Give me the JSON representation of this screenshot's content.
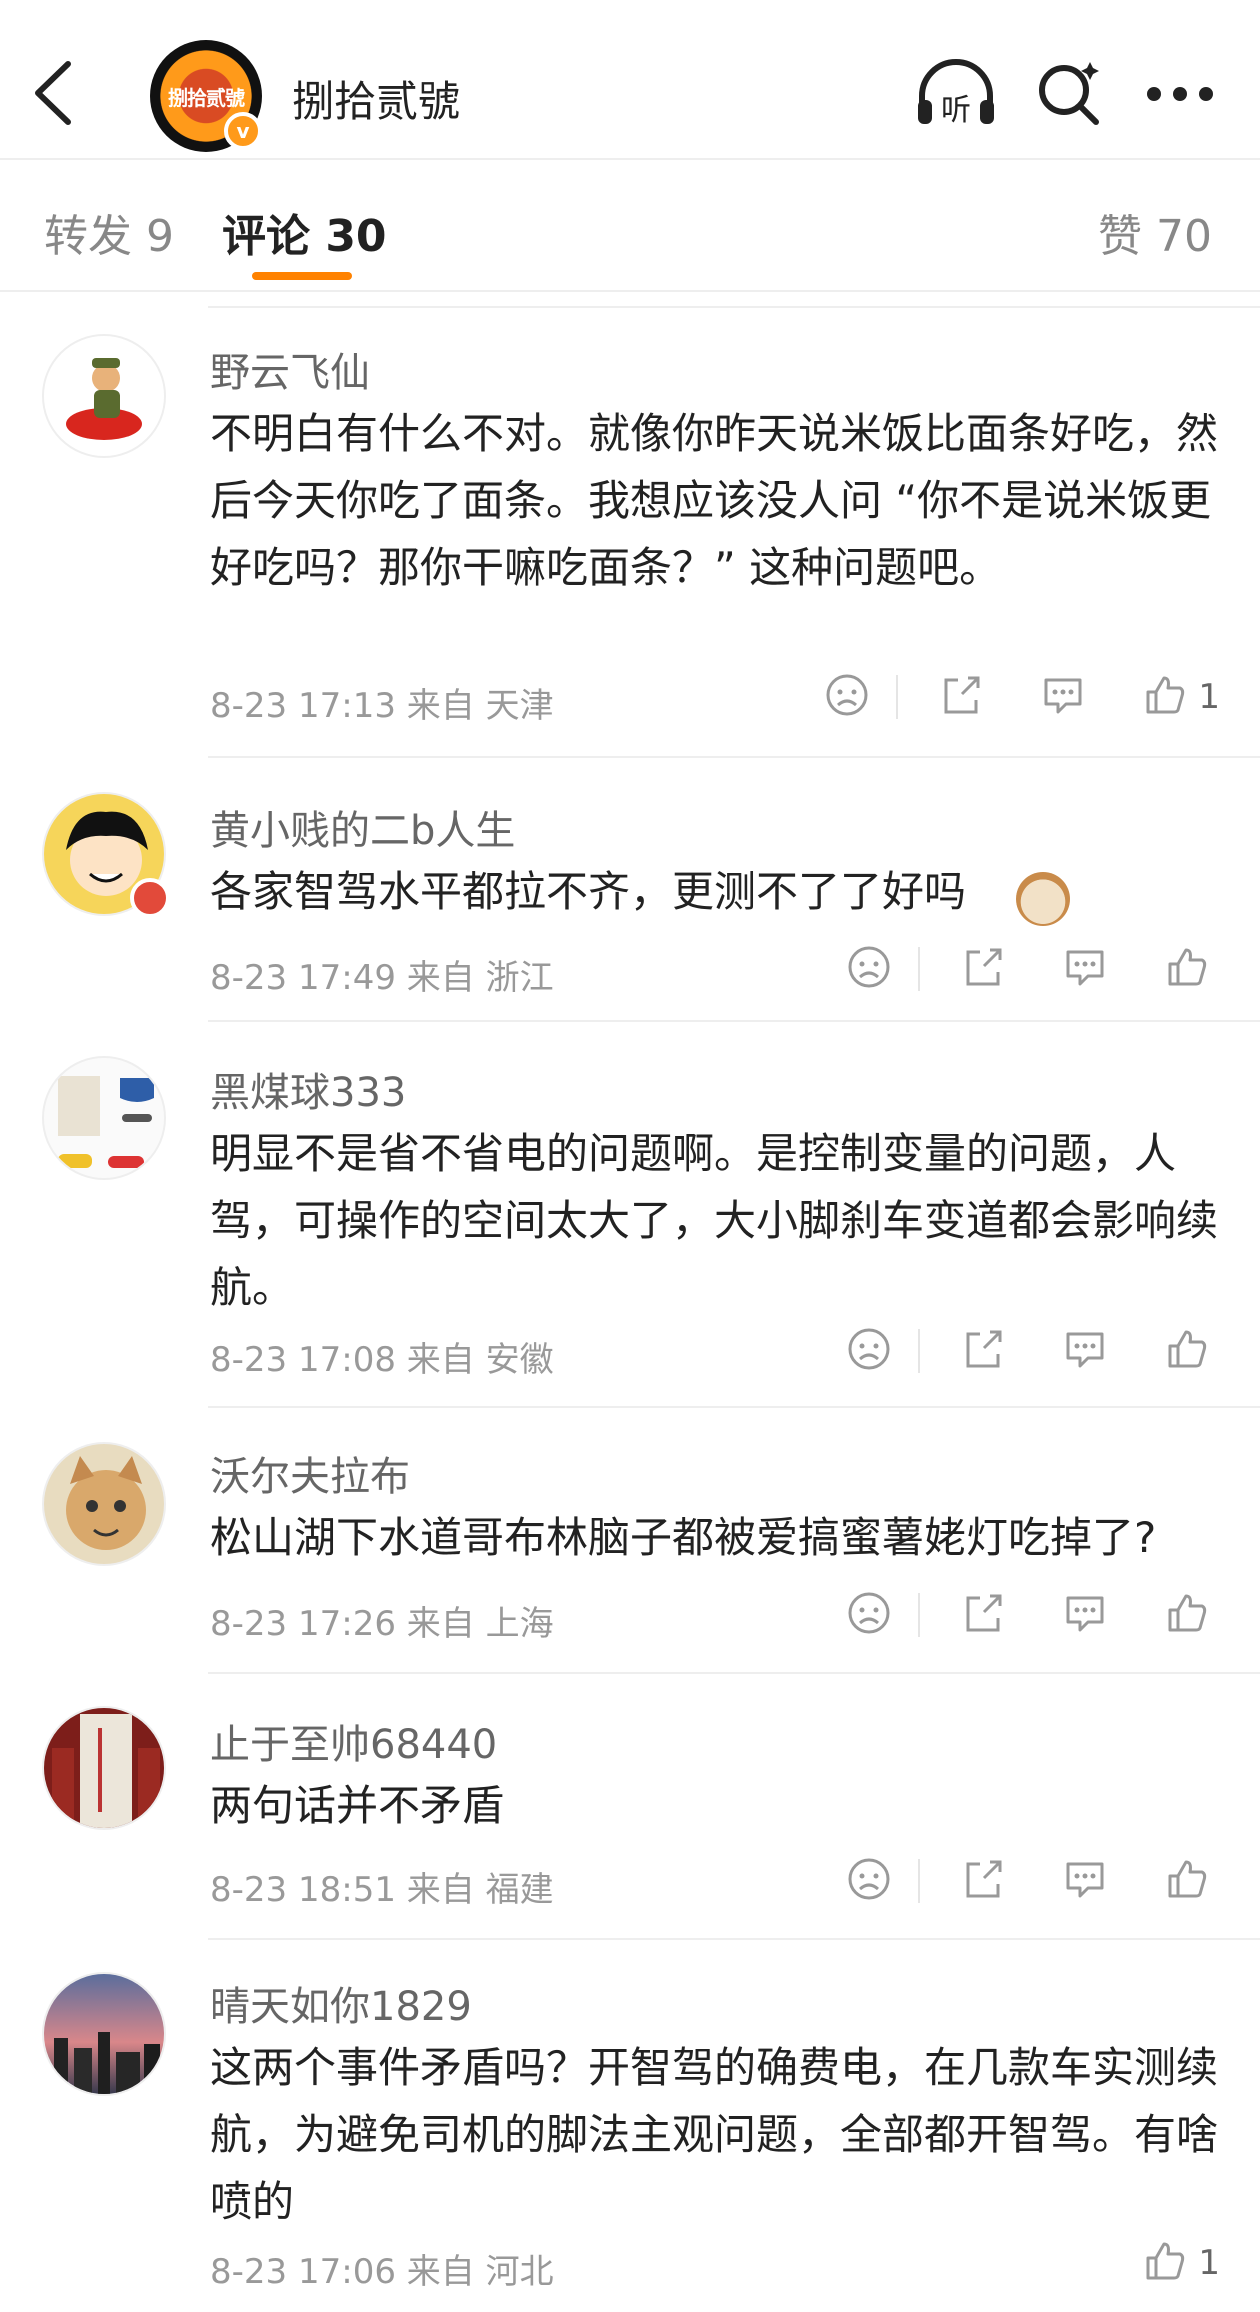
{
  "header": {
    "account_name": "捌拾贰號",
    "avatar_logo_text": "捌拾贰號",
    "verified_badge": "v",
    "icons": [
      "back-icon",
      "listen-icon",
      "search-icon",
      "more-icon"
    ],
    "listen_label": "听"
  },
  "tabs": {
    "repost": "转发 9",
    "comments": "评论 30",
    "likes": "赞 70"
  },
  "colors": {
    "accent": "#ff8200",
    "verified": "#ff9a1a"
  },
  "comments": [
    {
      "name": "野云飞仙",
      "text": "不明白有什么不对。就像你昨天说米饭比面条好吃，然后今天你吃了面条。我想应该没人问 “你不是说米饭更好吃吗？那你干嘛吃面条？” 这种问题吧。",
      "meta": "8-23 17:13  来自 天津",
      "likes": "1"
    },
    {
      "name": "黄小贱的二b人生",
      "text": "各家智驾水平都拉不齐，更测不了了好吗",
      "meta": "8-23 17:49  来自 浙江",
      "likes": ""
    },
    {
      "name": "黑煤球333",
      "text": "明显不是省不省电的问题啊。是控制变量的问题，人驾，可操作的空间太大了，大小脚刹车变道都会影响续航。",
      "meta": "8-23 17:08  来自 安徽",
      "likes": ""
    },
    {
      "name": "沃尔夫拉布",
      "text": "松山湖下水道哥布林脑子都被爱搞蜜薯姥灯吃掉了?",
      "meta": "8-23 17:26  来自 上海",
      "likes": ""
    },
    {
      "name": "止于至帅68440",
      "text": "两句话并不矛盾",
      "meta": "8-23 18:51  来自 福建",
      "likes": ""
    },
    {
      "name": "晴天如你1829",
      "text": "这两个事件矛盾吗？开智驾的确费电，在几款车实测续航，为避免司机的脚法主观问题，全部都开智驾。有啥喷的",
      "meta": "8-23 17:06  来自 河北",
      "likes": "1"
    }
  ]
}
